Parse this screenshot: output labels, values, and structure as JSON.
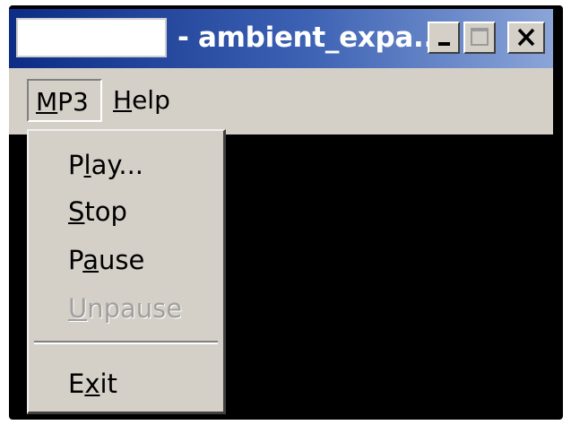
{
  "window": {
    "title_text": "- ambient_expa...",
    "title_input_value": ""
  },
  "title_buttons": [
    {
      "name": "minimize",
      "icon": "minimize-icon"
    },
    {
      "name": "maximize",
      "icon": "maximize-icon",
      "state": "disabled"
    },
    {
      "name": "close",
      "icon": "close-icon"
    }
  ],
  "menubar": {
    "items": [
      {
        "pre": "",
        "key": "M",
        "post": "P3"
      },
      {
        "pre": "",
        "key": "H",
        "post": "elp"
      }
    ]
  },
  "dropdown": {
    "items": [
      {
        "pre": "P",
        "key": "l",
        "post": "ay...",
        "enabled": true
      },
      {
        "pre": "",
        "key": "S",
        "post": "top",
        "enabled": true
      },
      {
        "pre": "P",
        "key": "a",
        "post": "use",
        "enabled": true
      },
      {
        "pre": "",
        "key": "U",
        "post": "npause",
        "enabled": false
      },
      {
        "pre": "E",
        "key": "x",
        "post": "it",
        "enabled": true
      }
    ]
  },
  "colors": {
    "titlebar_start": "#0c2c85",
    "titlebar_end": "#8ba5d8",
    "menu_bg": "#d4d0c8",
    "client_bg": "#000000",
    "disabled_text": "#a0a0a0"
  }
}
